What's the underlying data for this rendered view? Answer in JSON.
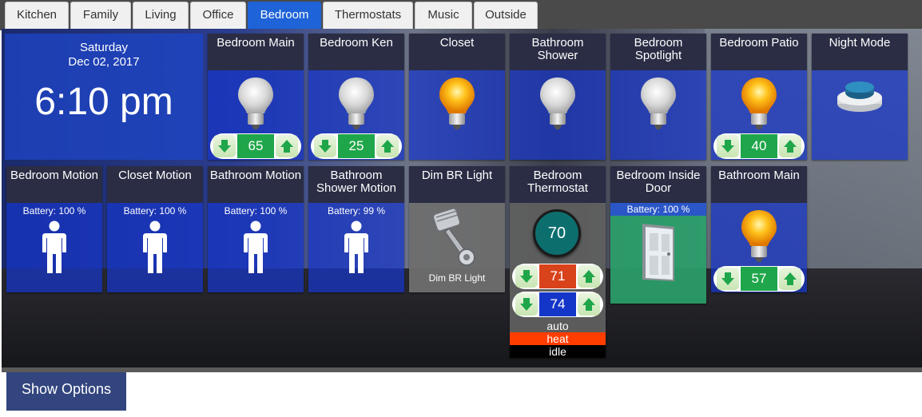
{
  "tabs": [
    "Kitchen",
    "Family",
    "Living",
    "Office",
    "Bedroom",
    "Thermostats",
    "Music",
    "Outside"
  ],
  "active_tab": "Bedroom",
  "clock": {
    "day": "Saturday",
    "date": "Dec 02, 2017",
    "time": "6:10 pm"
  },
  "tiles": {
    "bedroom_main": {
      "title": "Bedroom Main",
      "level": "65",
      "state": "off"
    },
    "bedroom_ken": {
      "title": "Bedroom Ken",
      "level": "25",
      "state": "off"
    },
    "closet": {
      "title": "Closet",
      "state": "on"
    },
    "bathroom_shower": {
      "title": "Bathroom Shower",
      "state": "off"
    },
    "bedroom_spotlight": {
      "title": "Bedroom Spotlight",
      "state": "off"
    },
    "bedroom_patio": {
      "title": "Bedroom Patio",
      "level": "40",
      "state": "on"
    },
    "night_mode": {
      "title": "Night Mode"
    },
    "bedroom_motion": {
      "title": "Bedroom Motion",
      "battery": "Battery: 100 %"
    },
    "closet_motion": {
      "title": "Closet Motion",
      "battery": "Battery: 100 %"
    },
    "bathroom_motion": {
      "title": "Bathroom Motion",
      "battery": "Battery: 100 %"
    },
    "bathroom_shower_motion": {
      "title": "Bathroom Shower Motion",
      "battery": "Battery: 99 %"
    },
    "dim_br_light": {
      "title": "Dim BR Light",
      "caption": "Dim BR Light"
    },
    "bedroom_thermostat": {
      "title": "Bedroom Thermostat",
      "current_temp": "70",
      "heat_setpoint": "71",
      "cool_setpoint": "74",
      "mode": "auto",
      "operating_mode": "heat",
      "state": "idle"
    },
    "bedroom_inside_door": {
      "title": "Bedroom Inside Door",
      "battery": "Battery: 100 %"
    },
    "bathroom_main": {
      "title": "Bathroom Main",
      "level": "57",
      "state": "on"
    }
  },
  "show_options_label": "Show Options",
  "colors": {
    "tab_active": "#1e63d8",
    "level_green": "#1fa64a",
    "heat_red": "#d8431c",
    "cool_blue": "#1436c8",
    "heat_bar": "#ff3d00",
    "door_tile": "#2aa06a"
  },
  "icons": {
    "light": "light-bulb-icon",
    "motion": "person-icon",
    "dim_scene": "piston-icon",
    "night_mode": "push-button-icon",
    "door": "door-icon",
    "dimmer_down": "arrow-down-icon",
    "dimmer_up": "arrow-up-icon"
  }
}
